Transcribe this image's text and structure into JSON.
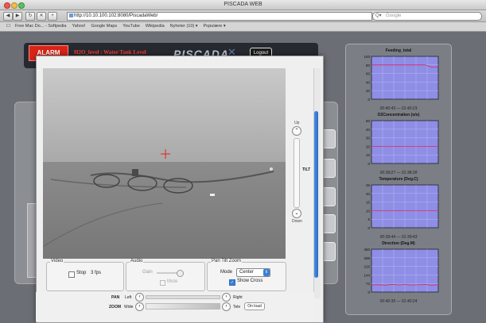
{
  "window": {
    "title": "PISCADA WEB"
  },
  "toolbar": {
    "url": "http://10.10.100.102:8080/PiscadaWeb/",
    "search_placeholder": "Google"
  },
  "bookmarks": [
    "Free Mac Do... - Softpedia",
    "Yahoo!",
    "Google Maps",
    "YouTube",
    "Wikipedia",
    "Nyheter (10) ▾",
    "Populære ▾"
  ],
  "header": {
    "alarm_label": "ALARM",
    "alarm_message": "H2O_level : Water Tank Level",
    "logo": "PISCADA",
    "logout_label": "Logout"
  },
  "colors": {
    "alarm": "#d82518",
    "chart_bg": "#8e8ee6",
    "chart_line": "#e0245a",
    "scroll_thumb": "#2a6cc4"
  },
  "charts": [
    {
      "title": "Feeding_total",
      "range": "00:40:43 — 01:40:23",
      "yticks": [
        "100",
        "80",
        "60",
        "40",
        "20",
        "0"
      ]
    },
    {
      "title": "O2Concentration (o/o)",
      "range": "00:39:27 — 01:38:28",
      "yticks": [
        "50",
        "40",
        "30",
        "20",
        "10",
        "0"
      ]
    },
    {
      "title": "Temperature (Deg.C)",
      "range": "00:39:44 — 01:39:43",
      "yticks": [
        "25",
        "20",
        "15",
        "10",
        "5",
        "0"
      ]
    },
    {
      "title": "Direction (Deg.M)",
      "range": "00:40:35 — 01:40:24",
      "yticks": [
        "360",
        "288",
        "216",
        "144",
        "72",
        "0"
      ]
    }
  ],
  "chart_data": [
    {
      "type": "line",
      "title": "Feeding_total",
      "ylim": [
        0,
        100
      ],
      "x": [
        0,
        1,
        2,
        3,
        4,
        5,
        6,
        7,
        8,
        9,
        10
      ],
      "series": [
        {
          "values": [
            80,
            80,
            80,
            80,
            80,
            80,
            80,
            80,
            80,
            75,
            75
          ]
        }
      ]
    },
    {
      "type": "line",
      "title": "O2Concentration (o/o)",
      "ylim": [
        0,
        50
      ],
      "x": [
        0,
        1,
        2,
        3,
        4,
        5,
        6,
        7,
        8,
        9,
        10
      ],
      "series": [
        {
          "values": [
            20,
            20,
            20,
            20,
            20,
            20,
            20,
            20,
            20,
            20,
            20
          ]
        }
      ]
    },
    {
      "type": "line",
      "title": "Temperature (Deg.C)",
      "ylim": [
        0,
        25
      ],
      "x": [
        0,
        1,
        2,
        3,
        4,
        5,
        6,
        7,
        8,
        9,
        10
      ],
      "series": [
        {
          "values": [
            10,
            10,
            10,
            10,
            10,
            10,
            10,
            10,
            10,
            10,
            10
          ]
        }
      ]
    },
    {
      "type": "line",
      "title": "Direction (Deg.M)",
      "ylim": [
        0,
        360
      ],
      "x": [
        0,
        1,
        2,
        3,
        4,
        5,
        6,
        7,
        8,
        9,
        10
      ],
      "series": [
        {
          "values": [
            60,
            62,
            58,
            65,
            60,
            63,
            59,
            61,
            64,
            58,
            62
          ]
        }
      ]
    }
  ],
  "popup": {
    "tilt": {
      "up": "Up",
      "label": "TILT",
      "down": "Down"
    },
    "video": {
      "label": "Video",
      "stop": "Stop",
      "fps": "3 fps"
    },
    "audio": {
      "label": "Audio",
      "gain": "Gain",
      "mute": "Mute"
    },
    "ptz": {
      "label": "Pan Tilt Zoom",
      "mode_label": "Mode",
      "mode_value": "Center",
      "show_cross": "Show Cross"
    },
    "pan": {
      "label": "PAN",
      "left": "Left",
      "right": "Right"
    },
    "zoom": {
      "label": "ZOOM",
      "wide": "Wide",
      "tele": "Tele",
      "onload": "On load"
    }
  }
}
